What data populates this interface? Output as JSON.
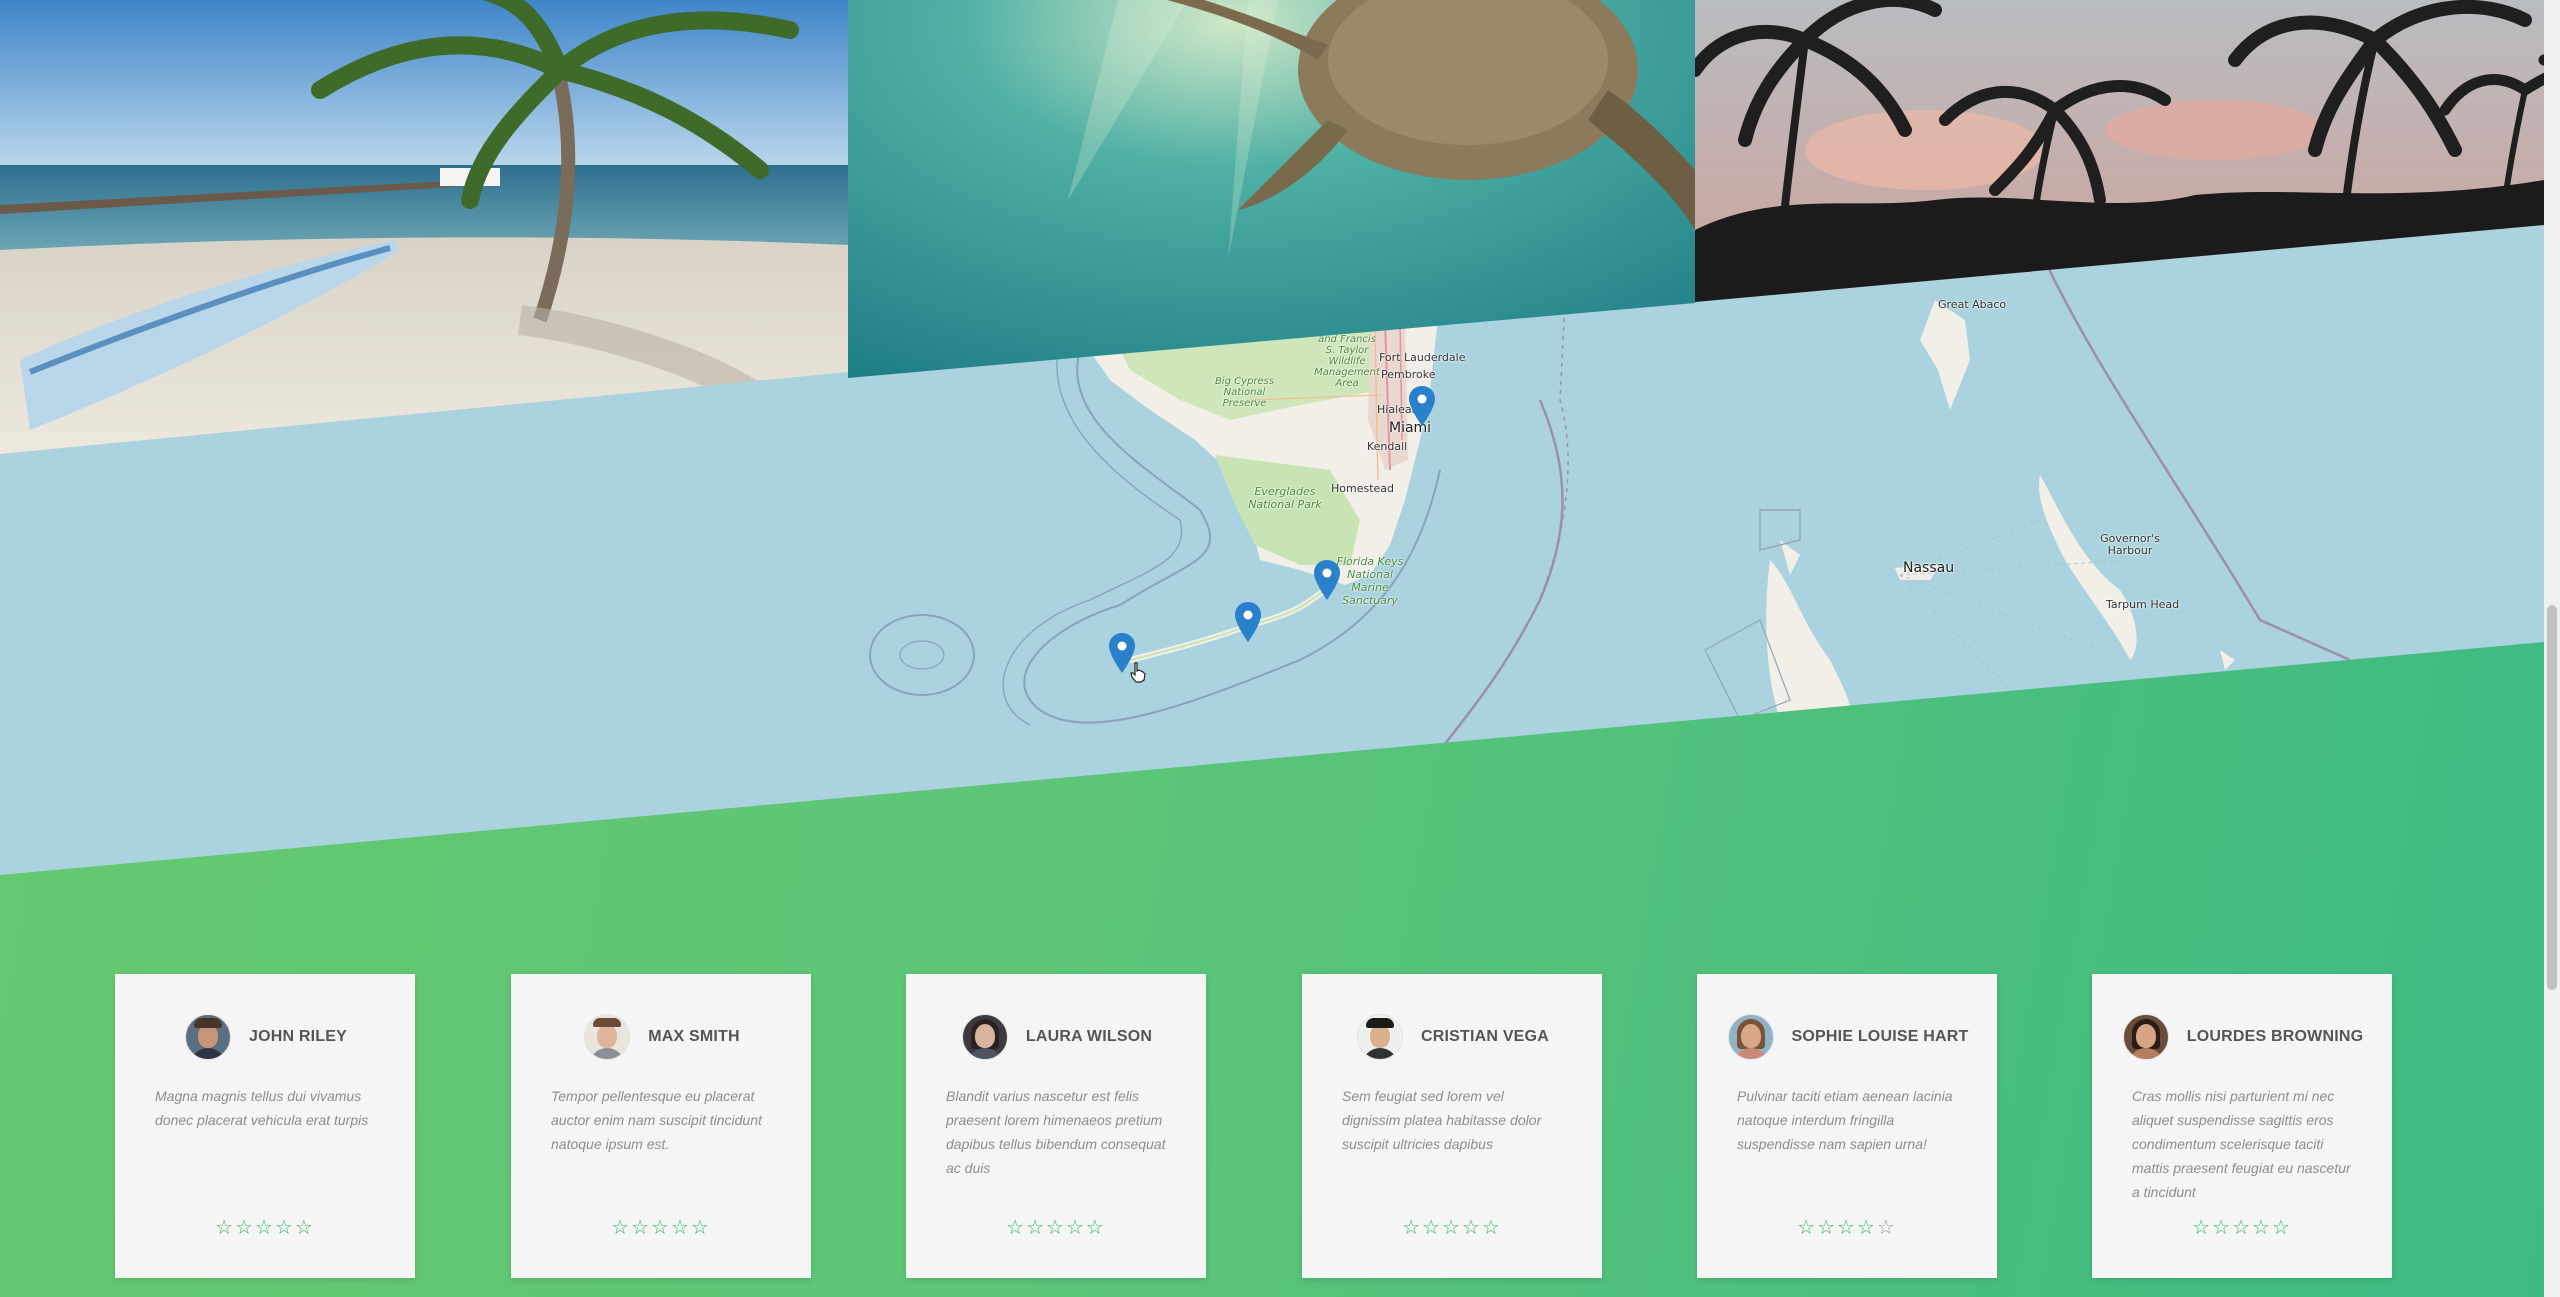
{
  "photos": [
    {
      "name": "beach-pier-photo",
      "alt": "Beach with palm tree, canoe and pier"
    },
    {
      "name": "sea-turtle-photo",
      "alt": "Sea turtle swimming underwater"
    },
    {
      "name": "palm-silhouettes-photo",
      "alt": "Palm tree silhouettes at sunset"
    }
  ],
  "map": {
    "labels": {
      "fort_lauderdale": "Fort Lauderdale",
      "pembroke": "Pembroke",
      "miami": "Miami",
      "hialeah": "Hialeah",
      "kendall": "Kendall",
      "homestead": "Homestead",
      "great_abaco": "Great Abaco",
      "nassau": "Nassau",
      "governors_harbour": "Governor's Harbour",
      "tarpum_head": "Tarpum Head",
      "everglades": "Everglades National Park",
      "big_cypress": "Big Cypress National Preserve",
      "florida_keys_sanctuary": "Florida Keys National Marine Sanctuary",
      "wildlife_area": "and Francis S. Taylor Wildlife Management Area"
    },
    "markers": [
      {
        "name": "map-marker-miami"
      },
      {
        "name": "map-marker-key-largo"
      },
      {
        "name": "map-marker-marathon"
      },
      {
        "name": "map-marker-lower-keys"
      }
    ]
  },
  "colors": {
    "water": "#aad3df",
    "land": "#f2efe9",
    "park": "#c8e4b4",
    "marker": "#2a81cb",
    "green_start": "#67c96f",
    "green_end": "#3dba82",
    "star": "#3bb36b"
  },
  "reviews": [
    {
      "name": "JOHN RILEY",
      "text": "Magna magnis tellus dui vivamus donec placerat vehicula erat turpis",
      "rating": 5
    },
    {
      "name": "MAX SMITH",
      "text": "Tempor pellentesque eu placerat auctor enim nam suscipit tincidunt natoque ipsum est.",
      "rating": 5
    },
    {
      "name": "LAURA WILSON",
      "text": "Blandit varius nascetur est felis praesent lorem himenaeos pretium dapibus tellus bibendum consequat ac duis",
      "rating": 5
    },
    {
      "name": "CRISTIAN VEGA",
      "text": "Sem feugiat sed lorem vel dignissim platea habitasse dolor suscipit ultricies dapibus",
      "rating": 5
    },
    {
      "name": "SOPHIE LOUISE HART",
      "text": "Pulvinar taciti etiam aenean lacinia natoque interdum fringilla suspendisse nam sapien urna!",
      "rating": 4
    },
    {
      "name": "LOURDES BROWNING",
      "text": "Cras mollis nisi parturient mi nec aliquet suspendisse sagittis eros condimentum scelerisque taciti mattis praesent feugiat eu nascetur a tincidunt",
      "rating": 5
    }
  ]
}
